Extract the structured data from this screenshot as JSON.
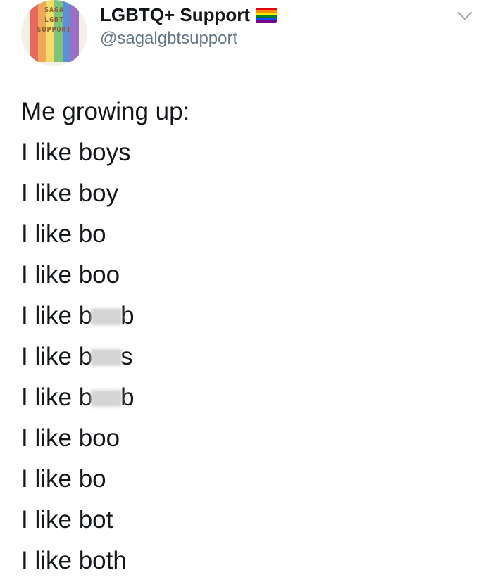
{
  "account": {
    "display_name": "LGBTQ+ Support",
    "handle": "@sagalgbtsupport",
    "avatar_lines": [
      "SAGA",
      "LGBT",
      "SUPPORT"
    ],
    "flag_colors": [
      "#e40303",
      "#ff8c00",
      "#ffed00",
      "#008026",
      "#004dff",
      "#750787"
    ],
    "avatar_icon": "rainbow-flag-logo",
    "verified_badge_icon": "rainbow-flag-icon",
    "menu_icon": "chevron-down-icon"
  },
  "tweet": {
    "lines": [
      {
        "before": "Me growing up:",
        "censored": false,
        "after": ""
      },
      {
        "before": "I like boys",
        "censored": false,
        "after": ""
      },
      {
        "before": "I like boy",
        "censored": false,
        "after": ""
      },
      {
        "before": "I like bo",
        "censored": false,
        "after": ""
      },
      {
        "before": "I like boo",
        "censored": false,
        "after": ""
      },
      {
        "before": "I like b",
        "censored": true,
        "after": "b"
      },
      {
        "before": "I like b",
        "censored": true,
        "after": "s"
      },
      {
        "before": "I like b",
        "censored": true,
        "after": "b"
      },
      {
        "before": "I like boo",
        "censored": false,
        "after": ""
      },
      {
        "before": "I like bo",
        "censored": false,
        "after": ""
      },
      {
        "before": "I like bot",
        "censored": false,
        "after": ""
      },
      {
        "before": "I like both",
        "censored": false,
        "after": ""
      }
    ]
  }
}
